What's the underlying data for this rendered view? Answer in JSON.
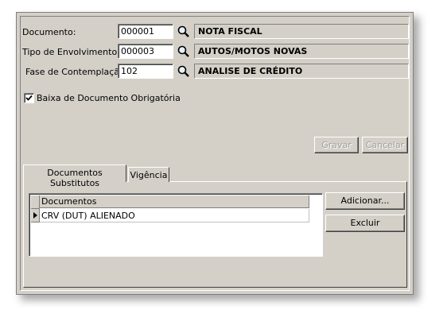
{
  "form": {
    "documento": {
      "label": "Documento:",
      "code": "000001",
      "description": "NOTA FISCAL"
    },
    "tipo": {
      "label": "Tipo de Envolvimento:",
      "code": "000003",
      "description": "AUTOS/MOTOS NOVAS"
    },
    "fase": {
      "label": "Fase de Contemplação:",
      "code": "102",
      "description": "ANALISE DE CRÉDITO"
    },
    "checkbox": {
      "label": "Baixa de Documento Obrigatória",
      "checked": true
    }
  },
  "actions": {
    "gravar": "Gravar",
    "cancelar": "Cancelar"
  },
  "tabs": [
    "Documentos Substitutos",
    "Vigência"
  ],
  "grid": {
    "header": "Documentos",
    "rows": [
      "CRV (DUT) ALIENADO"
    ]
  },
  "grid_actions": {
    "adicionar": "Adicionar...",
    "excluir": "Excluir"
  }
}
